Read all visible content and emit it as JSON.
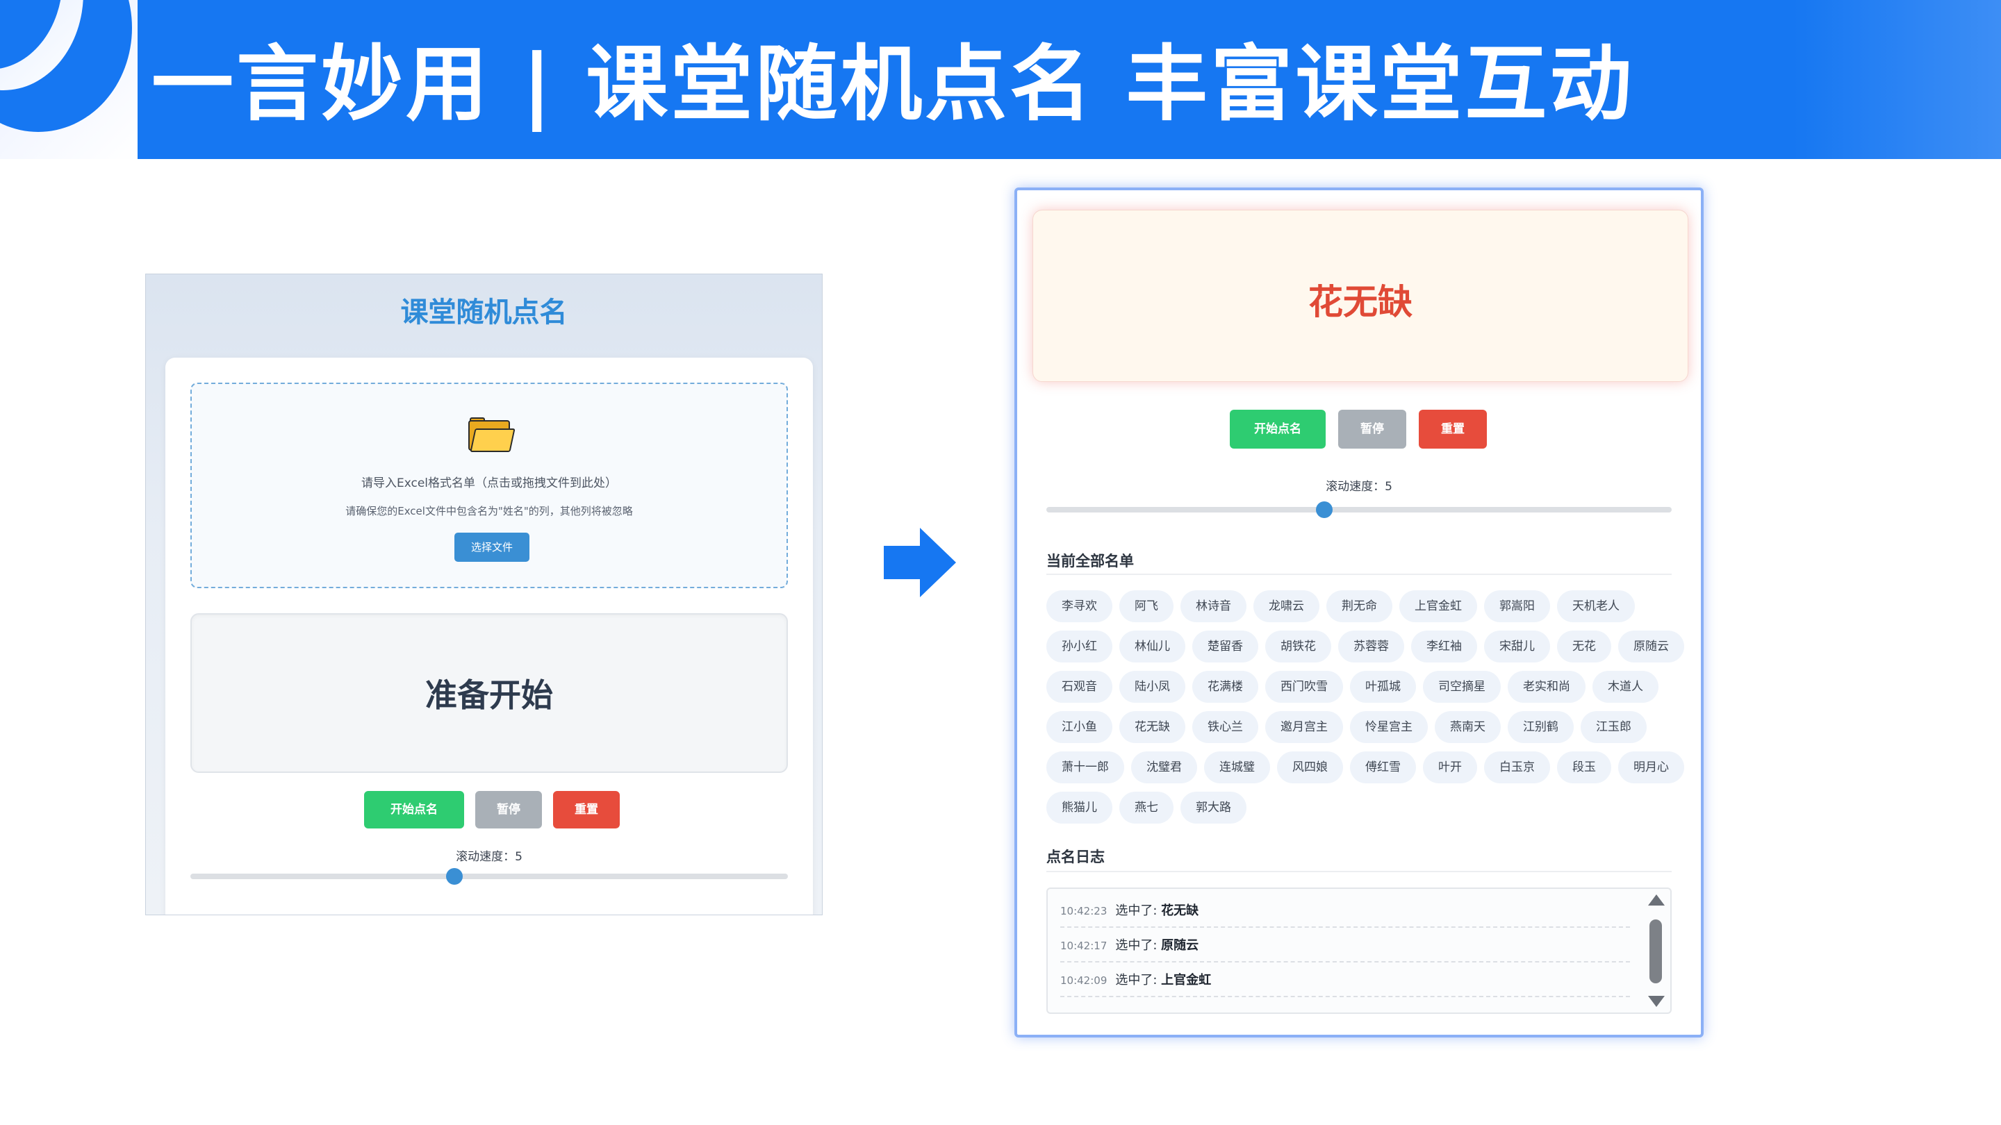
{
  "banner": {
    "title": "一言妙用 | 课堂随机点名 丰富课堂互动"
  },
  "left_app": {
    "title": "课堂随机点名",
    "upload": {
      "icon": "folder-icon",
      "main_text": "请导入Excel格式名单（点击或拖拽文件到此处）",
      "sub_text": "请确保您的Excel文件中包含名为\"姓名\"的列，其他列将被忽略",
      "choose_button": "选择文件"
    },
    "display_text": "准备开始",
    "buttons": {
      "start": "开始点名",
      "pause": "暂停",
      "reset": "重置"
    },
    "speed_label": "滚动速度：5",
    "speed_value": 5
  },
  "arrow_icon": "arrow-right-icon",
  "right_app": {
    "chosen_name": "花无缺",
    "buttons": {
      "start": "开始点名",
      "pause": "暂停",
      "reset": "重置"
    },
    "speed_label": "滚动速度：5",
    "speed_value": 5,
    "roster_title": "当前全部名单",
    "roster": [
      [
        "李寻欢",
        "阿飞",
        "林诗音",
        "龙啸云",
        "荆无命",
        "上官金虹",
        "郭嵩阳",
        "天机老人"
      ],
      [
        "孙小红",
        "林仙儿",
        "楚留香",
        "胡铁花",
        "苏蓉蓉",
        "李红袖",
        "宋甜儿",
        "无花",
        "原随云"
      ],
      [
        "石观音",
        "陆小凤",
        "花满楼",
        "西门吹雪",
        "叶孤城",
        "司空摘星",
        "老实和尚",
        "木道人"
      ],
      [
        "江小鱼",
        "花无缺",
        "铁心兰",
        "邀月宫主",
        "怜星宫主",
        "燕南天",
        "江别鹤",
        "江玉郎"
      ],
      [
        "萧十一郎",
        "沈璧君",
        "连城璧",
        "风四娘",
        "傅红雪",
        "叶开",
        "白玉京",
        "段玉",
        "明月心"
      ],
      [
        "熊猫儿",
        "燕七",
        "郭大路"
      ]
    ],
    "log_title": "点名日志",
    "log": [
      {
        "time": "10:42:23",
        "text": "选中了: ",
        "name": "花无缺"
      },
      {
        "time": "10:42:17",
        "text": "选中了: ",
        "name": "原随云"
      },
      {
        "time": "10:42:09",
        "text": "选中了: ",
        "name": "上官金虹"
      }
    ]
  },
  "colors": {
    "banner_blue": "#1677f2",
    "start_green": "#2ecc71",
    "pause_grey": "#a9b0b7",
    "reset_red": "#e74c3c",
    "accent_blue": "#3a8fd4",
    "chosen_red": "#e04a36"
  }
}
